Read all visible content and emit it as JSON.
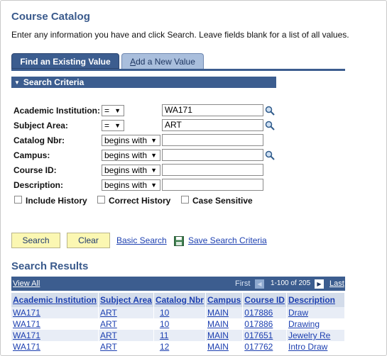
{
  "page": {
    "title": "Course Catalog",
    "instructions": "Enter any information you have and click Search. Leave fields blank for a list of all values."
  },
  "tabs": {
    "find_existing": "Find an Existing Value",
    "add_new_prefix": "A",
    "add_new_rest": "dd a New Value"
  },
  "criteria": {
    "header": "Search Criteria",
    "academic_institution": {
      "label": "Academic Institution:",
      "operator": "=",
      "value": "WA171"
    },
    "subject_area": {
      "label": "Subject Area:",
      "operator": "=",
      "value": "ART"
    },
    "catalog_nbr": {
      "label": "Catalog Nbr:",
      "operator": "begins with",
      "value": ""
    },
    "campus": {
      "label": "Campus:",
      "operator": "begins with",
      "value": ""
    },
    "course_id": {
      "label": "Course ID:",
      "operator": "begins with",
      "value": ""
    },
    "description": {
      "label": "Description:",
      "operator": "begins with",
      "value": ""
    },
    "include_history": "Include History",
    "correct_history": "Correct History",
    "case_sensitive": "Case Sensitive"
  },
  "actions": {
    "search": "Search",
    "clear": "Clear",
    "basic_search": "Basic Search",
    "save_criteria": "Save Search Criteria"
  },
  "results": {
    "title": "Search Results",
    "view_all": "View All",
    "first": "First",
    "range": "1-100 of 205",
    "last": "Last",
    "columns": [
      "Academic Institution",
      "Subject Area",
      "Catalog Nbr",
      "Campus",
      "Course ID",
      "Description"
    ],
    "rows": [
      [
        "WA171",
        "ART",
        "10",
        "MAIN",
        "017886",
        "Draw"
      ],
      [
        "WA171",
        "ART",
        "10",
        "MAIN",
        "017886",
        "Drawing"
      ],
      [
        "WA171",
        "ART",
        "11",
        "MAIN",
        "017651",
        "Jewelry Re"
      ],
      [
        "WA171",
        "ART",
        "12",
        "MAIN",
        "017762",
        "Intro Draw"
      ]
    ]
  },
  "icons": {
    "lookup": "magnifier-icon",
    "save": "floppy-disk-icon",
    "prev": "triangle-left-icon",
    "next": "triangle-right-icon",
    "collapse": "triangle-down-icon"
  },
  "colors": {
    "accent": "#3c5d8f",
    "link": "#1c3fb0",
    "button": "#fbf7b2"
  }
}
